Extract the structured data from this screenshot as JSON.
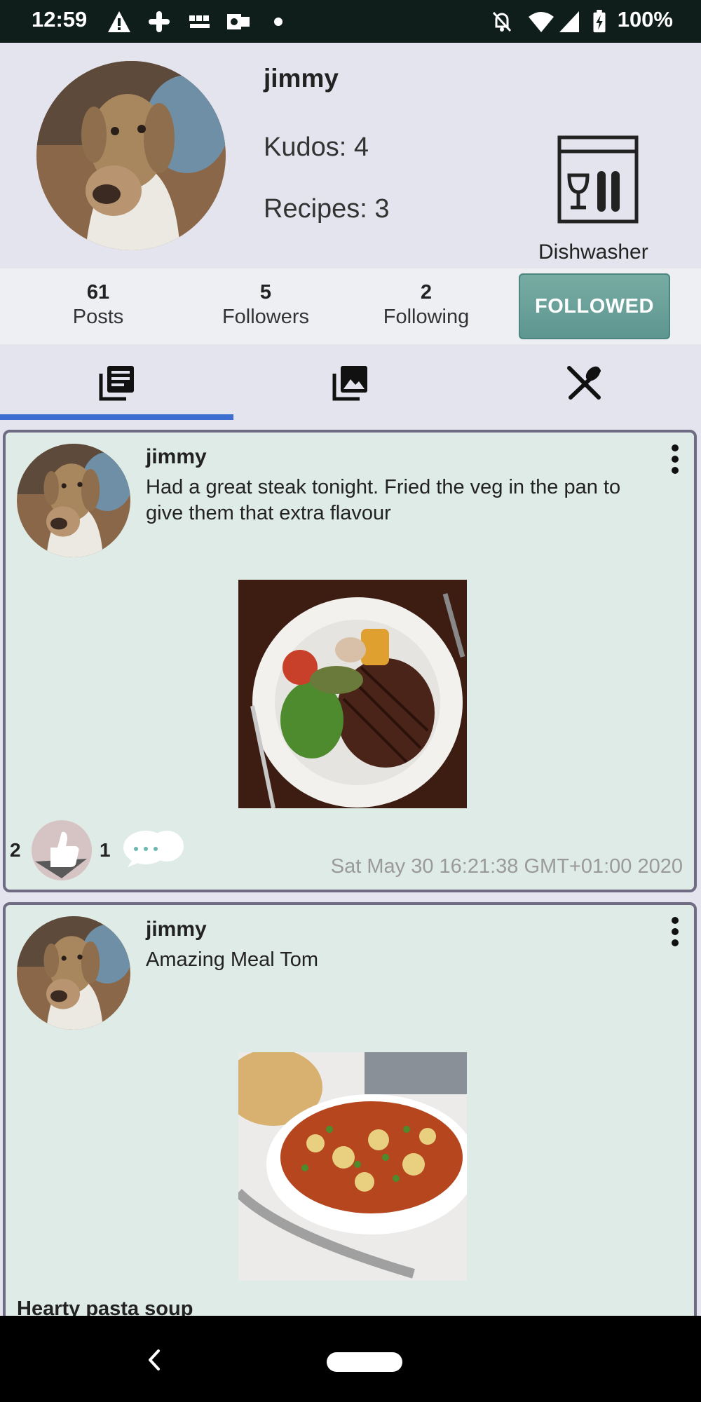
{
  "status_bar": {
    "time": "12:59",
    "battery": "100%",
    "icons": [
      "warning-icon",
      "slack-icon",
      "bbc-news-icon",
      "outlook-icon",
      "dot-icon",
      "bell-off-icon",
      "wifi-icon",
      "signal-icon",
      "battery-charging-icon"
    ]
  },
  "profile": {
    "name": "jimmy",
    "kudos": "Kudos: 4",
    "recipes": "Recipes: 3",
    "badge_label": "Dishwasher",
    "badge_icon": "dishwasher-icon",
    "stats": [
      {
        "num": "61",
        "label": "Posts"
      },
      {
        "num": "5",
        "label": "Followers"
      },
      {
        "num": "2",
        "label": "Following"
      }
    ],
    "follow_button": "FOLLOWED"
  },
  "tabs": [
    {
      "icon": "posts-icon",
      "selected": true
    },
    {
      "icon": "photos-icon",
      "selected": false
    },
    {
      "icon": "recipes-icon",
      "selected": false
    }
  ],
  "posts": [
    {
      "author": "jimmy",
      "text": "Had a great steak tonight. Fried the veg in the pan to give them that extra flavour",
      "image": "steak dinner plate",
      "likes": "2",
      "comments": "1",
      "timestamp": "Sat May 30 16:21:38 GMT+01:00 2020"
    },
    {
      "author": "jimmy",
      "text": "Amazing Meal Tom",
      "image": "bowl of pasta soup",
      "recipe_title": "Hearty pasta soup"
    }
  ],
  "colors": {
    "status_bar": "#0f1e1a",
    "profile_bg": "#e4e4ee",
    "card_bg": "#dfebe7",
    "card_border": "#6e6b82",
    "followed_button": "#6aa09a",
    "tab_indicator": "#3d6fd0"
  }
}
